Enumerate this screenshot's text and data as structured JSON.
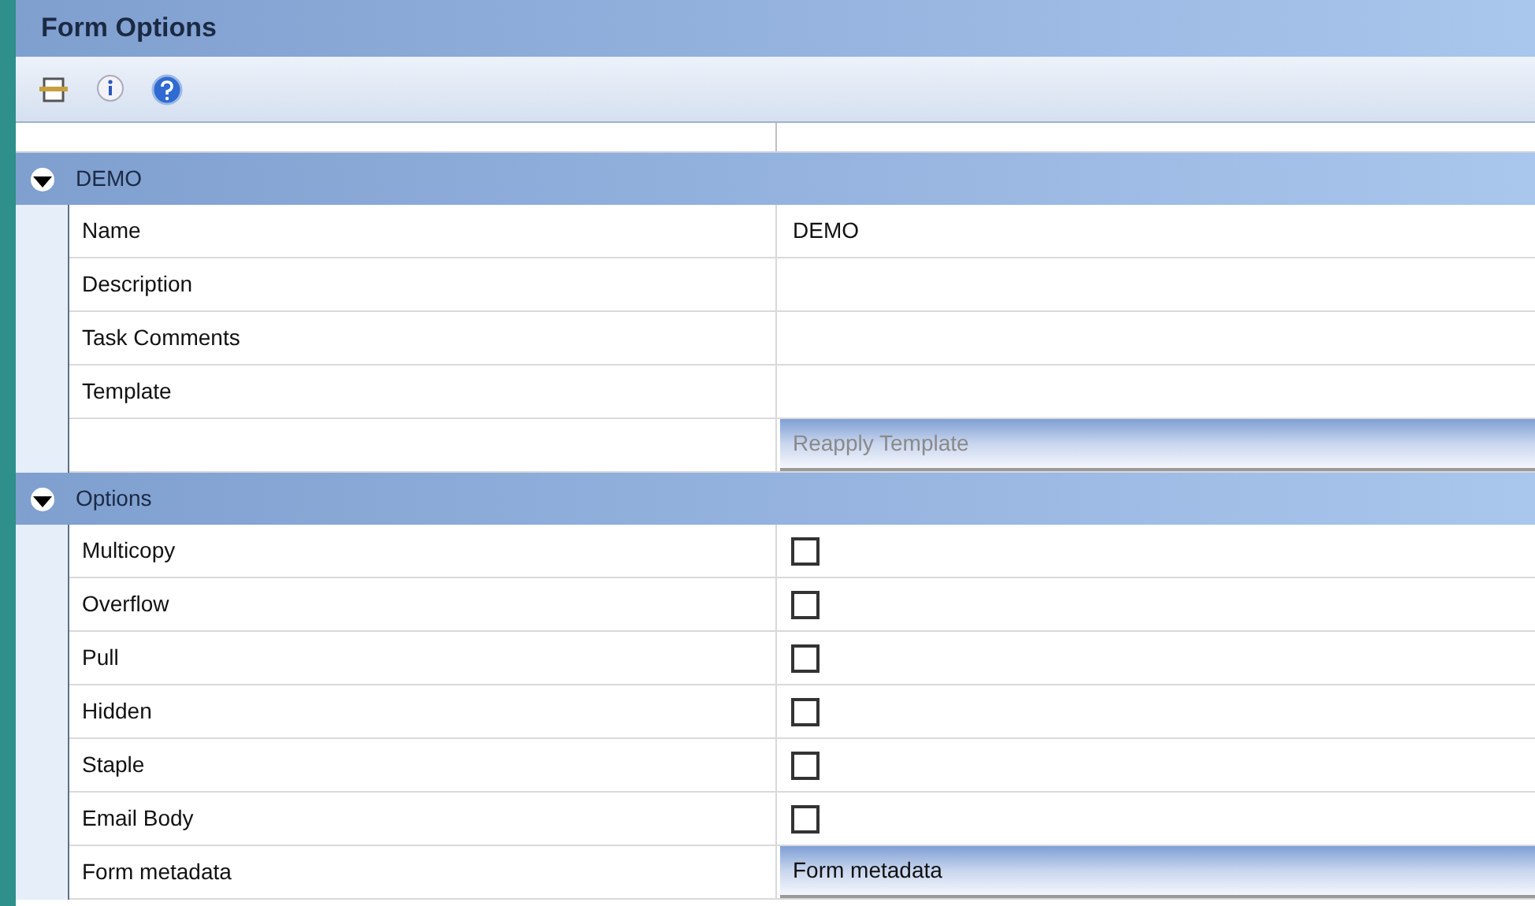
{
  "window": {
    "title": "Form Options"
  },
  "categories": [
    {
      "label": "DEMO",
      "expanded": true,
      "rows": [
        {
          "kind": "text",
          "label": "Name",
          "value": "DEMO"
        },
        {
          "kind": "text",
          "label": "Description"
        },
        {
          "kind": "text",
          "label": "Task Comments"
        },
        {
          "kind": "text",
          "label": "Template"
        },
        {
          "kind": "button",
          "button": "Reapply Template",
          "disabled": true
        }
      ]
    },
    {
      "label": "Options",
      "expanded": true,
      "rows": [
        {
          "kind": "checkbox",
          "label": "Multicopy",
          "checked": false
        },
        {
          "kind": "checkbox",
          "label": "Overflow",
          "checked": false
        },
        {
          "kind": "checkbox",
          "label": "Pull",
          "checked": false
        },
        {
          "kind": "checkbox",
          "label": "Hidden",
          "checked": false
        },
        {
          "kind": "checkbox",
          "label": "Staple",
          "checked": false
        },
        {
          "kind": "checkbox",
          "label": "Email Body",
          "checked": false
        },
        {
          "kind": "button",
          "label": "Form metadata",
          "button": "Form metadata",
          "disabled": false
        }
      ]
    }
  ]
}
